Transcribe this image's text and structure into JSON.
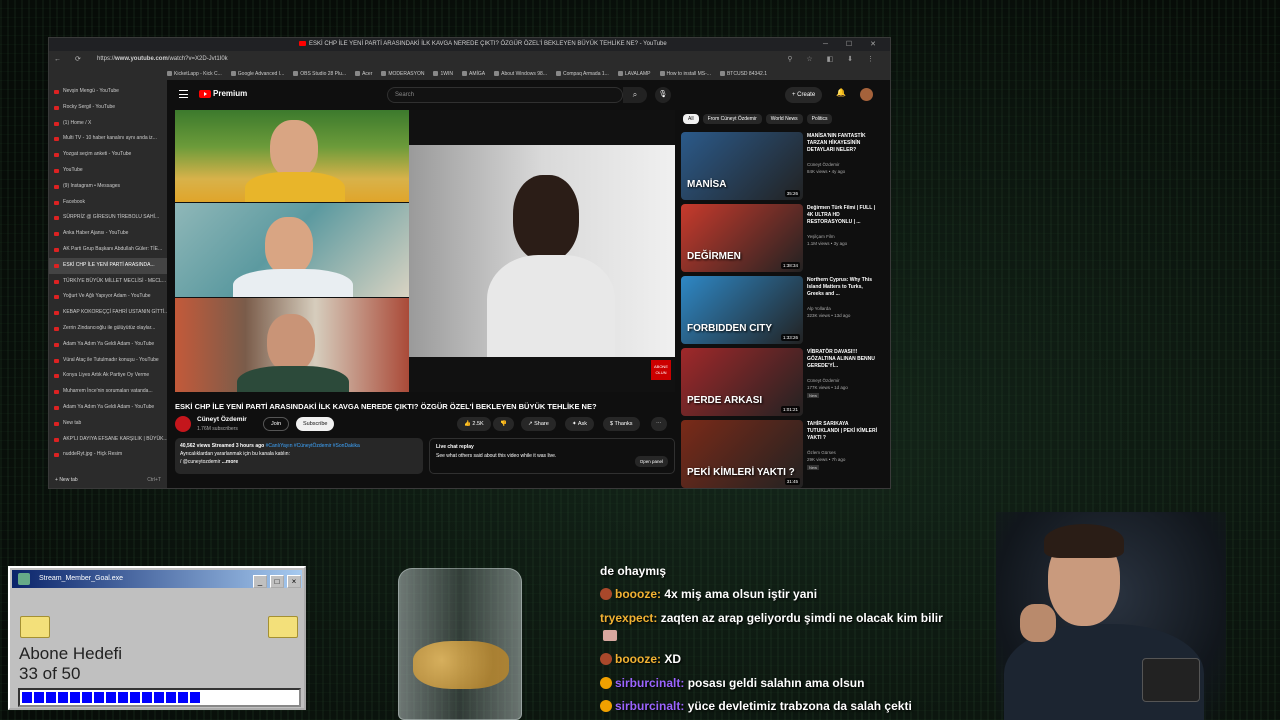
{
  "browser": {
    "window_title": "ESKİ CHP İLE YENİ PARTİ ARASINDAKİ İLK KAVGA NEREDE ÇIKTI? ÖZGÜR ÖZEL'İ BEKLEYEN BÜYÜK TEHLİKE NE? - YouTube",
    "url_prefix": "https://",
    "url_host": "www.youtube.com",
    "url_path": "/watch?v=X2D-Jvt1I0k",
    "bookmarks": [
      "KicketLapp - Kick C...",
      "Google Advanced I...",
      "OBS Studio 28 Plu...",
      "Acer",
      "MODERASYON",
      "1WIN",
      "AMİGA",
      "About Windows 98...",
      "Compaq Armada 1...",
      "LAVALAMP",
      "How to install MS-...",
      "BTCUSD 84342.1"
    ],
    "tabs": [
      "Nevşin Mengü - YouTube",
      "Rocky Sergil - YouTube",
      "(1) Home / X",
      "Multi TV - 10 haber kanalını aynı anda iz...",
      "Yozgat seçim anketi - YouTube",
      "YouTube",
      "(9) Instagram • Messages",
      "Facebook",
      "SÜRPRİZ @ GİRESUN TİREBOLU SAHİ...",
      "Anka Haber Ajansı - YouTube",
      "AK Parti Grup Başkanı Abdullah Güler: TİE...",
      "ESKİ CHP İLE YENİ PARTİ ARASINDA...",
      "TÜRKİYE BÜYÜK MİLLET MECLİSİ - MECL...",
      "Yoğurt Ve Ağlı Yapıyor Adam - YouTube",
      "KEBAP KOKOREÇÇİ FAHRİ USTANIN GİTTİ...",
      "Zerrin Zindancıoğlu ile gülüyütüz olaylar...",
      "Adam Ya Adım Ya Geldi Adam - YouTube",
      "Vüral Ataç ile Tutulmadır konuşu - YouTube",
      "Konya Liyes Artık Ak Partiye Oy Verme",
      "Muharrem İnce'nin sorumaları vatanda...",
      "Adam Ya Adım Ya Geldi Adam - YouTube",
      "New tab",
      "AKP'LI DAYIYA EFSANE KARŞILIK | BÜYÜK...",
      "nuddeRyt.jpg - Hiçk Resim"
    ],
    "active_tab_index": 11,
    "new_tab": "New tab",
    "new_tab_shortcut": "Ctrl+T"
  },
  "youtube": {
    "logo": "Premium",
    "search_placeholder": "Search",
    "create_label": "Create",
    "video_title": "ESKİ CHP İLE YENİ PARTİ ARASINDAKİ İLK KAVGA NEREDE ÇIKTI? ÖZGÜR ÖZEL'İ BEKLEYEN BÜYÜK TEHLİKE NE?",
    "channel": "Cüneyt Özdemir",
    "subscribers": "1.76M subscribers",
    "join": "Join",
    "subscribe": "Subscribe",
    "likes": "2.5K",
    "share": "Share",
    "ask": "Ask",
    "thanks": "Thanks",
    "abone_badge": "ABONE OLUN",
    "description": {
      "views": "40,562 views",
      "streamed": "Streamed 3 hours ago",
      "tags": "#CanlıYayın #CüneytÖzdemir #SonDakika",
      "line2": "Ayrıcalıklardan yararlanmak için bu kanala katılın:",
      "line3": "/ @cuneytozdemir",
      "more": "...more"
    },
    "live_chat": {
      "title": "Live chat replay",
      "text": "See what others said about this video while it was live.",
      "button": "Open panel"
    },
    "chips": [
      "All",
      "From Cüneyt Özdemir",
      "World News",
      "Politics"
    ],
    "recommendations": [
      {
        "title": "MANİSA'NIN FANTASTİK TARZAN HİKAYESİNİN DETAYLARI NELER?",
        "channel": "Cüneyt Özdemir",
        "meta": "84K views • 4y ago",
        "duration": "35:26",
        "thumb_text": "MANİSA",
        "thumb_color": "#2b5a8a",
        "badge": ""
      },
      {
        "title": "Değirmen Türk Filmi | FULL | 4K ULTRA HD RESTORASYONLU | ...",
        "channel": "Yeşilçam Film",
        "meta": "1.1M views • 3y ago",
        "duration": "1:38:34",
        "thumb_text": "DEĞİRMEN",
        "thumb_color": "#c83a2c",
        "badge": ""
      },
      {
        "title": "Northern Cyprus: Why This Island Matters to Turks, Greeks and ...",
        "channel": "Alp Yollarda",
        "meta": "323K views • 13d ago",
        "duration": "1:33:26",
        "thumb_text": "FORBIDDEN CITY",
        "thumb_color": "#2e88c6",
        "badge": ""
      },
      {
        "title": "VİBRATÖR DAVASI!!! GÖZALTINA ALINAN BENNU GEREDE'Yİ...",
        "channel": "Cüneyt Özdemir",
        "meta": "177K views • 1d ago",
        "duration": "1:01:21",
        "thumb_text": "PERDE ARKASI",
        "thumb_color": "#a0282a",
        "badge": "New"
      },
      {
        "title": "TAHİR SARIKAYA TUTUKLANDI | PEKİ KİMLERİ YAKTI ?",
        "channel": "Özlem Gürses",
        "meta": "29K views • 7h ago",
        "duration": "31:45",
        "thumb_text": "PEKİ KİMLERİ YAKTI ?",
        "thumb_color": "#7a2a18",
        "badge": "New"
      }
    ]
  },
  "goal_widget": {
    "title": "Stream_Member_Goal.exe",
    "label": "Abone Hedefi",
    "count_text": "33 of 50",
    "progress_fraction": 0.66
  },
  "chat": [
    {
      "user": "",
      "user_color": "#ffffff",
      "text": "de ohaymış",
      "badge": ""
    },
    {
      "user": "boooze:",
      "user_color": "#f2b233",
      "text": " 4x miş ama olsun iştir yani",
      "badge": "#a9482b"
    },
    {
      "user": "tryexpect:",
      "user_color": "#f2b233",
      "text": " zaqten az arap geliyordu şimdi ne olacak kim bilir",
      "badge": ""
    },
    {
      "user": "boooze:",
      "user_color": "#f2b233",
      "text": " XD",
      "badge": "#a9482b"
    },
    {
      "user": "sirburcinalt:",
      "user_color": "#9b64ff",
      "text": " posası geldi salahın ama olsun",
      "badge": "#f0a000"
    },
    {
      "user": "sirburcinalt:",
      "user_color": "#9b64ff",
      "text": " yüce devletimiz trabzona da salah çekti",
      "badge": "#f0a000"
    }
  ]
}
